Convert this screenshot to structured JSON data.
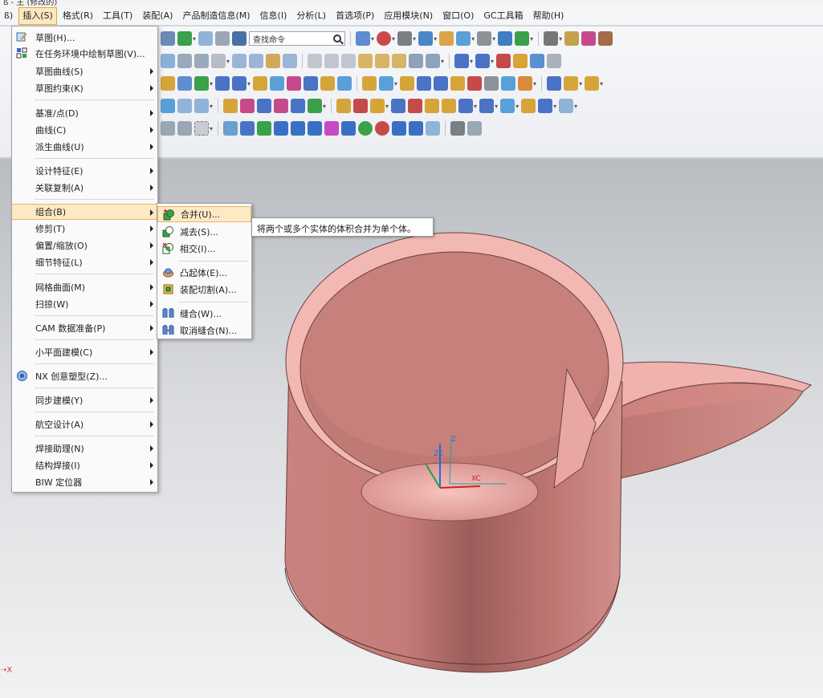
{
  "titlebar": {
    "text": "ß - 主 (修改的)"
  },
  "menubar": [
    {
      "label": "ß)",
      "active": false
    },
    {
      "label": "插入(S)",
      "active": true
    },
    {
      "label": "格式(R)",
      "active": false
    },
    {
      "label": "工具(T)",
      "active": false
    },
    {
      "label": "装配(A)",
      "active": false
    },
    {
      "label": "产品制造信息(M)",
      "active": false
    },
    {
      "label": "信息(I)",
      "active": false
    },
    {
      "label": "分析(L)",
      "active": false
    },
    {
      "label": "首选项(P)",
      "active": false
    },
    {
      "label": "应用模块(N)",
      "active": false
    },
    {
      "label": "窗口(O)",
      "active": false
    },
    {
      "label": "GC工具箱",
      "active": false
    },
    {
      "label": "帮助(H)",
      "active": false
    }
  ],
  "toolbar": {
    "search_placeholder": "查找命令"
  },
  "insert_menu": {
    "items": [
      {
        "label": "草图(H)...",
        "icon": "sketch-icon",
        "has_sub": false
      },
      {
        "label": "在任务环境中绘制草图(V)...",
        "icon": "sketch-task-icon",
        "has_sub": false
      },
      {
        "label": "草图曲线(S)",
        "icon": "",
        "has_sub": true
      },
      {
        "label": "草图约束(K)",
        "icon": "",
        "has_sub": true
      },
      {
        "label": "基准/点(D)",
        "icon": "",
        "has_sub": true
      },
      {
        "label": "曲线(C)",
        "icon": "",
        "has_sub": true
      },
      {
        "label": "派生曲线(U)",
        "icon": "",
        "has_sub": true
      },
      {
        "label": "设计特征(E)",
        "icon": "",
        "has_sub": true
      },
      {
        "label": "关联复制(A)",
        "icon": "",
        "has_sub": true
      },
      {
        "label": "组合(B)",
        "icon": "",
        "has_sub": true
      },
      {
        "label": "修剪(T)",
        "icon": "",
        "has_sub": true
      },
      {
        "label": "偏置/缩放(O)",
        "icon": "",
        "has_sub": true
      },
      {
        "label": "细节特征(L)",
        "icon": "",
        "has_sub": true
      },
      {
        "label": "网格曲面(M)",
        "icon": "",
        "has_sub": true
      },
      {
        "label": "扫掠(W)",
        "icon": "",
        "has_sub": true
      },
      {
        "label": "CAM 数据准备(P)",
        "icon": "",
        "has_sub": true
      },
      {
        "label": "小平面建模(C)",
        "icon": "",
        "has_sub": true
      },
      {
        "label": "NX 创意塑型(Z)...",
        "icon": "nx-realize-icon",
        "has_sub": false
      },
      {
        "label": "同步建模(Y)",
        "icon": "",
        "has_sub": true
      },
      {
        "label": "航空设计(A)",
        "icon": "",
        "has_sub": true
      },
      {
        "label": "焊接助理(N)",
        "icon": "",
        "has_sub": true
      },
      {
        "label": "结构焊接(I)",
        "icon": "",
        "has_sub": true
      },
      {
        "label": "BIW 定位器",
        "icon": "",
        "has_sub": true
      }
    ],
    "highlighted": "组合(B)"
  },
  "combine_submenu": {
    "items": [
      {
        "label": "合并(U)...",
        "icon": "unite-icon"
      },
      {
        "label": "减去(S)...",
        "icon": "subtract-icon"
      },
      {
        "label": "相交(I)...",
        "icon": "intersect-icon"
      },
      {
        "label": "凸起体(E)...",
        "icon": "emboss-body-icon"
      },
      {
        "label": "装配切割(A)...",
        "icon": "assembly-cut-icon"
      },
      {
        "label": "缝合(W)...",
        "icon": "sew-icon"
      },
      {
        "label": "取消缝合(N)...",
        "icon": "unsew-icon"
      }
    ],
    "highlighted": "合并(U)..."
  },
  "tooltip": {
    "text": "将两个或多个实体的体积合并为单个体。"
  },
  "viewport": {
    "axis_x_label": "X",
    "csys_labels": {
      "zc": "ZC",
      "xc": "XC",
      "z": "Z"
    },
    "model_color": "#d98b87"
  }
}
